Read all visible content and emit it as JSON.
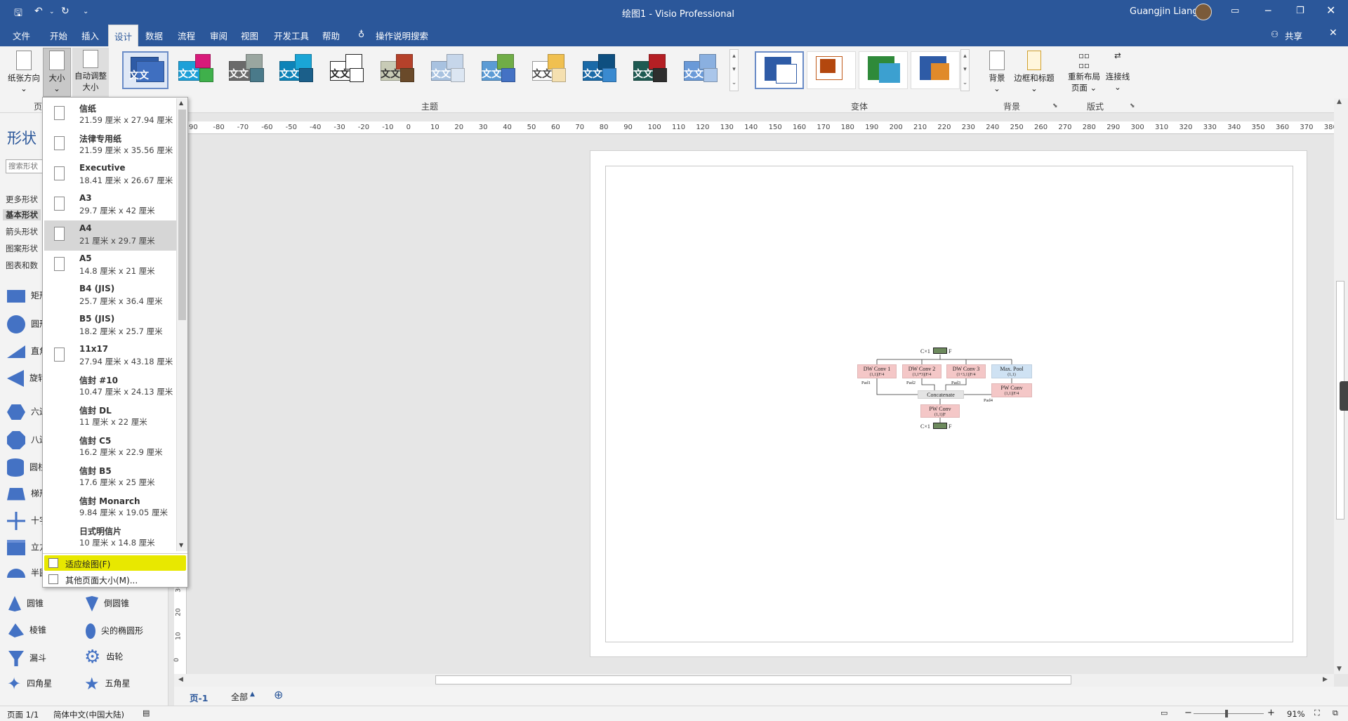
{
  "window": {
    "title": "绘图1  -  Visio Professional",
    "user": "Guangjin Liang"
  },
  "tabs": [
    "文件",
    "开始",
    "插入",
    "设计",
    "数据",
    "流程",
    "审阅",
    "视图",
    "开发工具",
    "帮助"
  ],
  "search_tab": "操作说明搜索",
  "share": "共享",
  "ribbon": {
    "orientation": "纸张方向",
    "size": "大小",
    "autosize_1": "自动调整",
    "autosize_2": "大小",
    "page_group_partial": "页",
    "themes_label": "主题",
    "theme_text": "文文",
    "variants_label": "变体",
    "background": "背景",
    "borders_titles": "边框和标题",
    "background_group": "背景",
    "relayout_1": "重新布局",
    "relayout_2": "页面",
    "connectors": "连接线",
    "layout_group": "版式"
  },
  "shapes_pane": {
    "title": "形状",
    "search_placeholder": "搜索形状",
    "categories": [
      "更多形状",
      "基本形状",
      "箭头形状",
      "图案形状",
      "图表和数"
    ],
    "shapes_left_partial": [
      "矩形",
      "圆形",
      "直角",
      "旋转",
      "六边",
      "八边",
      "圆柱",
      "梯形",
      "十字",
      "立方",
      "半圆"
    ],
    "shapes_bottom": [
      [
        "圆锥",
        "倒圆锥"
      ],
      [
        "棱锥",
        "尖的椭圆形"
      ],
      [
        "漏斗",
        "齿轮"
      ],
      [
        "四角星",
        "五角星"
      ]
    ]
  },
  "size_dropdown": {
    "items": [
      {
        "name": "信纸",
        "dims": "21.59 厘米 x 27.94 厘米"
      },
      {
        "name": "法律专用纸",
        "dims": "21.59 厘米 x 35.56 厘米"
      },
      {
        "name": "Executive",
        "dims": "18.41 厘米 x 26.67 厘米"
      },
      {
        "name": "A3",
        "dims": "29.7 厘米 x 42 厘米"
      },
      {
        "name": "A4",
        "dims": "21 厘米 x 29.7 厘米"
      },
      {
        "name": "A5",
        "dims": "14.8 厘米 x 21 厘米"
      },
      {
        "name": "B4 (JIS)",
        "dims": "25.7 厘米 x 36.4 厘米"
      },
      {
        "name": "B5 (JIS)",
        "dims": "18.2 厘米 x 25.7 厘米"
      },
      {
        "name": "11x17",
        "dims": "27.94 厘米 x 43.18 厘米"
      },
      {
        "name": "信封 #10",
        "dims": "10.47 厘米 x 24.13 厘米"
      },
      {
        "name": "信封 DL",
        "dims": "11 厘米 x 22 厘米"
      },
      {
        "name": "信封 C5",
        "dims": "16.2 厘米 x 22.9 厘米"
      },
      {
        "name": "信封 B5",
        "dims": "17.6 厘米 x 25 厘米"
      },
      {
        "name": "信封 Monarch",
        "dims": "9.84 厘米 x 19.05 厘米"
      },
      {
        "name": "日式明信片",
        "dims": "10 厘米 x 14.8 厘米"
      }
    ],
    "selected": "A4",
    "fit_to_drawing": "适应绘图(F)",
    "more_sizes": "其他页面大小(M)..."
  },
  "ruler": {
    "h_ticks": [
      "90",
      "-80",
      "-70",
      "-60",
      "-50",
      "-40",
      "-30",
      "-20",
      "-10",
      "0",
      "10",
      "20",
      "30",
      "40",
      "50",
      "60",
      "70",
      "80",
      "90",
      "100",
      "110",
      "120",
      "130",
      "140",
      "150",
      "160",
      "170",
      "180",
      "190",
      "200",
      "210",
      "220",
      "230",
      "240",
      "250",
      "260",
      "270",
      "280",
      "290",
      "300",
      "310",
      "320",
      "330",
      "340",
      "350",
      "360",
      "370",
      "380"
    ],
    "v_ticks": [
      "30",
      "20",
      "10",
      "0"
    ]
  },
  "diagram": {
    "dw1": "DW Conv 1",
    "dw1_sub": "(1,1)|F/4",
    "dw2": "DW Conv 2",
    "dw2_sub": "(1,1*3)|F/4",
    "dw3": "DW Conv 3",
    "dw3_sub": "(1+3,1)|F/4",
    "maxpool": "Max. Pool",
    "maxpool_sub": "(1,1)",
    "pwconv_r": "PW Conv",
    "pwconv_r_sub": "(1,1)|F/4",
    "concat": "Concatenate",
    "pwconv": "PW Conv",
    "pwconv_sub": "(1,1)|F",
    "pad1": "Pad1",
    "pad2": "Pad2",
    "pad3": "Pad3",
    "pad4": "Pad4",
    "in_c": "C×1",
    "in_f": "F",
    "out_c": "C×1",
    "out_f": "F"
  },
  "page_tabs": {
    "page1": "页-1",
    "all": "全部"
  },
  "status": {
    "page": "页面 1/1",
    "language": "简体中文(中国大陆)",
    "zoom": "91%"
  },
  "colors": {
    "title_bar": "#2b579a",
    "highlight": "#e8e800",
    "dw_fill": "#f4c7c7",
    "pool_fill": "#cfe2f3",
    "concat_fill": "#e4e4e4"
  }
}
